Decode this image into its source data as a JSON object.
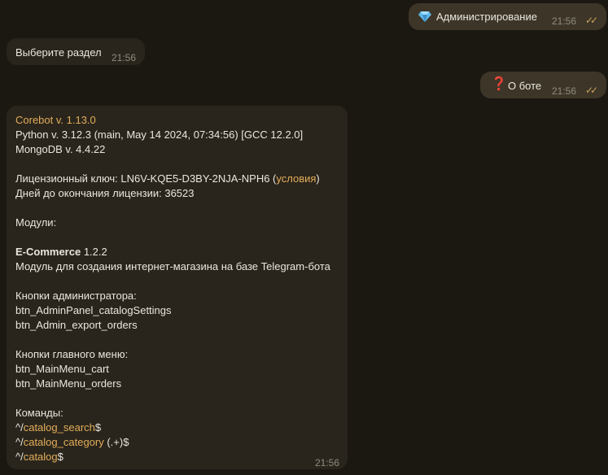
{
  "messages": {
    "m1": {
      "icon": "diamond-emoji",
      "text": "Администрирование",
      "time": "21:56",
      "status": "read"
    },
    "m2": {
      "text": "Выберите раздел",
      "time": "21:56"
    },
    "m3": {
      "icon": "red-question-emoji",
      "text": "О боте",
      "time": "21:56",
      "status": "read"
    },
    "m4": {
      "time": "21:56",
      "bot_name": "Corebot v. 1.13.0",
      "python": "Python v. 3.12.3 (main, May 14 2024, 07:34:56) [GCC 12.2.0]",
      "mongo": "MongoDB v. 4.4.22",
      "license_key_prefix": "Лицензионный ключ: LN6V-KQE5-D3BY-2NJA-NPH6 (",
      "license_terms_link": "условия",
      "license_key_suffix": ")",
      "license_days": "Дней до окончания лицензии: 36523",
      "modules_title": "Модули:",
      "module_name": "E-Commerce",
      "module_version": " 1.2.2",
      "module_desc": "Модуль для создания интернет-магазина на базе Telegram-бота",
      "admin_buttons_title": "Кнопки администратора:",
      "admin_buttons": [
        "btn_AdminPanel_catalogSettings",
        "btn_Admin_export_orders"
      ],
      "main_buttons_title": "Кнопки главного меню:",
      "main_buttons": [
        "btn_MainMenu_cart",
        "btn_MainMenu_orders"
      ],
      "commands_title": "Команды:",
      "cmd1": {
        "pre": "^/",
        "link": "catalog_search",
        "post": "$"
      },
      "cmd2": {
        "pre": "^/",
        "link": "catalog_category",
        "post": " (.+)$"
      },
      "cmd3": {
        "pre": "^/",
        "link": "catalog",
        "post": "$"
      }
    }
  },
  "colors": {
    "background": "#1b1812",
    "outgoing": "#3d3628",
    "incoming": "#2a251c",
    "accent": "#e2ad5a"
  }
}
